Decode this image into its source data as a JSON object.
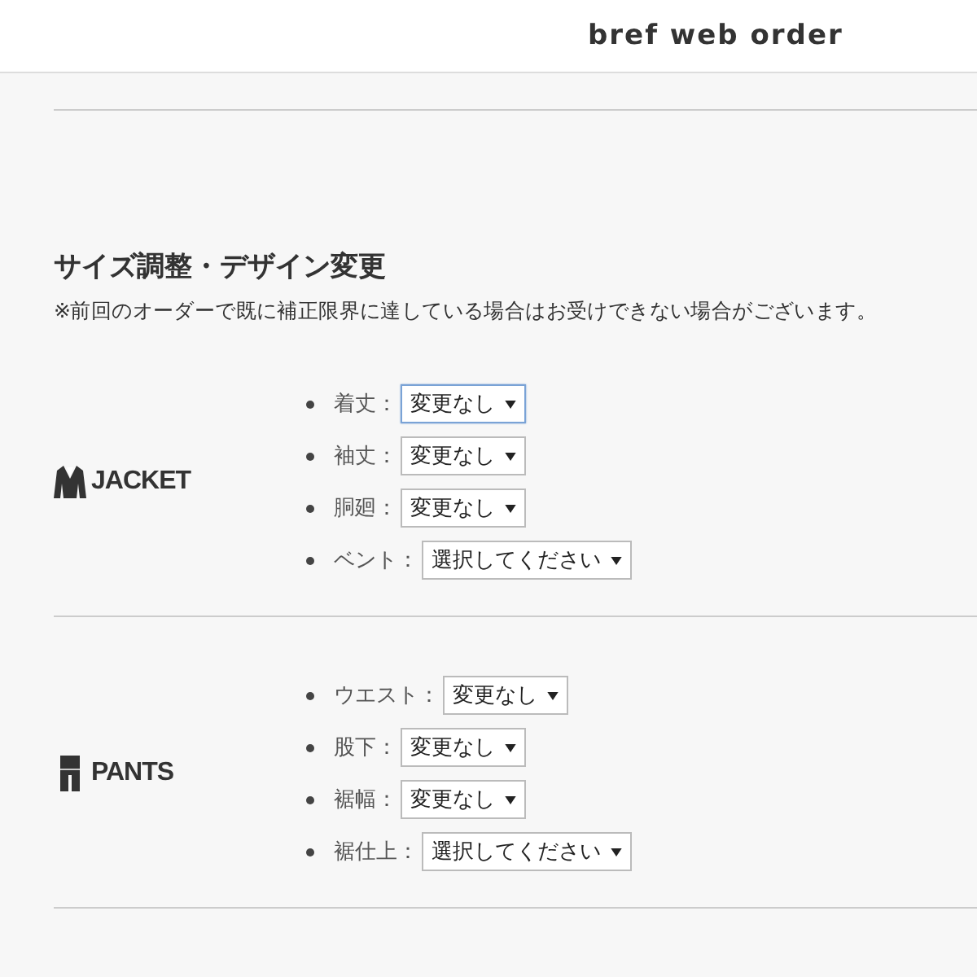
{
  "header": {
    "title": "bref web order"
  },
  "section": {
    "heading": "サイズ調整・デザイン変更",
    "note": "※前回のオーダーで既に補正限界に達している場合はお受けできない場合がございます。"
  },
  "groups": [
    {
      "kind": "jacket",
      "label": "JACKET",
      "items": [
        {
          "label": "着丈：",
          "value": "変更なし",
          "focused": true
        },
        {
          "label": "袖丈：",
          "value": "変更なし",
          "focused": false
        },
        {
          "label": "胴廻：",
          "value": "変更なし",
          "focused": false
        },
        {
          "label": "ベント：",
          "value": "選択してください",
          "focused": false
        }
      ]
    },
    {
      "kind": "pants",
      "label": "PANTS",
      "items": [
        {
          "label": "ウエスト：",
          "value": "変更なし",
          "focused": false
        },
        {
          "label": "股下：",
          "value": "変更なし",
          "focused": false
        },
        {
          "label": "裾幅：",
          "value": "変更なし",
          "focused": false
        },
        {
          "label": "裾仕上：",
          "value": "選択してください",
          "focused": false
        }
      ]
    }
  ]
}
